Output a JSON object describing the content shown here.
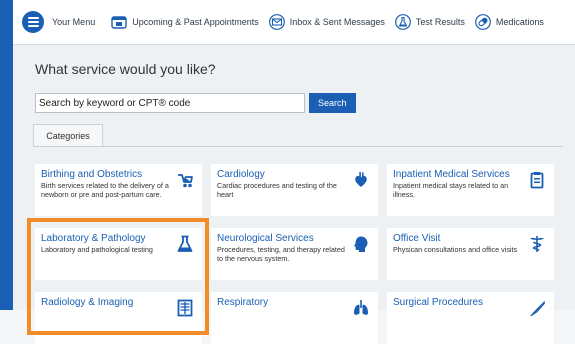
{
  "nav": {
    "menu_label": "Your Menu",
    "items": [
      {
        "label": "Upcoming & Past Appointments",
        "icon": "calendar-icon"
      },
      {
        "label": "Inbox & Sent Messages",
        "icon": "envelope-icon"
      },
      {
        "label": "Test Results",
        "icon": "flask-icon"
      },
      {
        "label": "Medications",
        "icon": "pill-icon"
      }
    ]
  },
  "main": {
    "heading": "What service would you like?",
    "search_placeholder": "Search by keyword or CPT® code",
    "search_button": "Search",
    "tab_label": "Categories"
  },
  "categories": [
    {
      "title": "Birthing and Obstetrics",
      "desc": "Birth services related to the delivery of a newborn or pre and post-partum care.",
      "icon": "stroller-icon"
    },
    {
      "title": "Cardiology",
      "desc": "Cardiac procedures and testing of the heart",
      "icon": "heart-icon"
    },
    {
      "title": "Inpatient Medical Services",
      "desc": "Inpatient medical stays related to an illness.",
      "icon": "clipboard-icon"
    },
    {
      "title": "Laboratory & Pathology",
      "desc": "Laboratory and pathological testing",
      "icon": "flask-icon"
    },
    {
      "title": "Neurological Services",
      "desc": "Procedures, testing, and therapy related to the nervous system.",
      "icon": "head-icon"
    },
    {
      "title": "Office Visit",
      "desc": "Physican consultations and office visits",
      "icon": "caduceus-icon"
    },
    {
      "title": "Radiology & Imaging",
      "desc": "",
      "icon": "xray-icon"
    },
    {
      "title": "Respiratory",
      "desc": "",
      "icon": "lungs-icon"
    },
    {
      "title": "Surgical Procedures",
      "desc": "",
      "icon": "scalpel-icon"
    }
  ],
  "colors": {
    "brand": "#1a5fb4",
    "highlight": "#f28c28",
    "link": "#1a5fb4"
  }
}
